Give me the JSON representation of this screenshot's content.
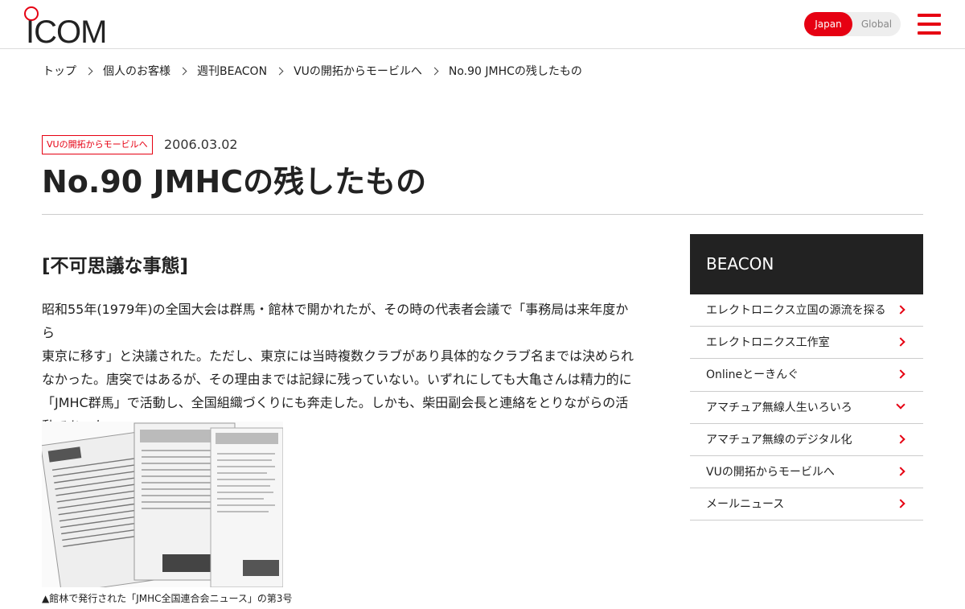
{
  "header": {
    "logo_text": "ICOM",
    "region": {
      "active": "Japan",
      "inactive": "Global"
    }
  },
  "breadcrumb": [
    "トップ",
    "個人のお客様",
    "週刊BEACON",
    "VUの開拓からモービルへ",
    "No.90 JMHCの残したもの"
  ],
  "article": {
    "category_tag": "VUの開拓からモービルへ",
    "date": "2006.03.02",
    "title": "No.90 JMHCの残したもの",
    "section_heading": "[不可思議な事態]",
    "body_lines": [
      "昭和55年(1979年)の全国大会は群馬・館林で開かれたが、その時の代表者会議で「事務局は来年度から",
      "東京に移す」と決議された。ただし、東京には当時複数クラブがあり具体的なクラブ名までは決められ",
      "なかった。唐突ではあるが、その理由までは記録に残っていない。いずれにしても大亀さんは精力的に",
      "「JMHC群馬」で活動し、全国組織づくりにも奔走した。しかも、柴田副会長と連絡をとりながらの活",
      "動であった。"
    ],
    "image_caption": "▲館林で発行された「JMHC全国連合会ニュース」の第3号"
  },
  "sidebar": {
    "title": "BEACON",
    "items": [
      {
        "label": "エレクトロニクス立国の源流を探る",
        "icon": "chevron-right-icon"
      },
      {
        "label": "エレクトロニクス工作室",
        "icon": "chevron-right-icon"
      },
      {
        "label": "Onlineとーきんぐ",
        "icon": "chevron-right-icon"
      },
      {
        "label": "アマチュア無線人生いろいろ",
        "icon": "chevron-down-icon"
      },
      {
        "label": "アマチュア無線のデジタル化",
        "icon": "chevron-right-icon"
      },
      {
        "label": "VUの開拓からモービルへ",
        "icon": "chevron-right-icon"
      },
      {
        "label": "メールニュース",
        "icon": "chevron-right-icon"
      }
    ]
  },
  "colors": {
    "accent": "#e60012",
    "dark": "#222222"
  }
}
